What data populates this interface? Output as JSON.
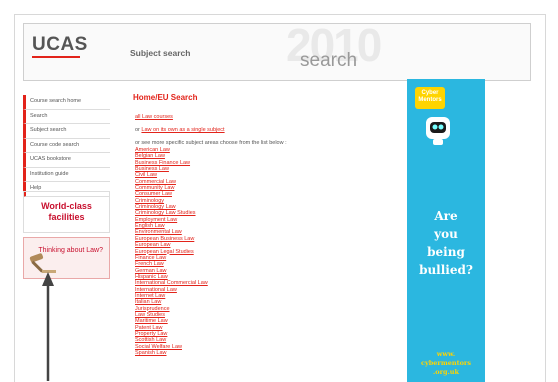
{
  "header": {
    "logo": "UCAS",
    "section": "Subject search",
    "year_watermark": "2010",
    "search_word": "search"
  },
  "sidebar": {
    "items": [
      {
        "label": "Course search home"
      },
      {
        "label": "Search"
      },
      {
        "label": "Subject search"
      },
      {
        "label": "Course code search"
      },
      {
        "label": "UCAS bookstore"
      },
      {
        "label": "Institution guide"
      },
      {
        "label": "Help"
      }
    ],
    "promo1": "World-class facilities",
    "promo2": "Thinking about Law?"
  },
  "main": {
    "title": "Home/EU Search",
    "all_link": "all Law courses",
    "or_prefix": "or",
    "single_link": "Law on its own as a single subject",
    "intro": "or see more specific subject areas choose from the list below :",
    "subjects": [
      "American Law",
      "Belgian Law",
      "Business Finance Law",
      "Business Law",
      "Civil Law",
      "Commercial Law",
      "Community Law",
      "Consumer Law",
      "Criminology",
      "Criminology Law",
      "Criminology Law Studies",
      "Employment Law",
      "English Law",
      "Environmental Law",
      "European Business Law",
      "European Law",
      "European Legal Studies",
      "Finance Law",
      "French Law",
      "German Law",
      "Hispanic Law",
      "International Commercial Law",
      "International Law",
      "Internet Law",
      "Italian Law",
      "Jurisprudence",
      "Law Studies",
      "Maritime Law",
      "Patent Law",
      "Property Law",
      "Scottish Law",
      "Social Welfare Law",
      "Spanish Law"
    ]
  },
  "ad": {
    "badge": "Cyber Mentors",
    "text_lines": [
      "Are",
      "you",
      "being",
      "bullied?"
    ],
    "url_lines": [
      "www.",
      "cybermentors",
      ".org.uk"
    ],
    "color_bg": "#2bb7e0",
    "color_accent": "#ffd400"
  },
  "colors": {
    "accent": "#e2231a"
  }
}
